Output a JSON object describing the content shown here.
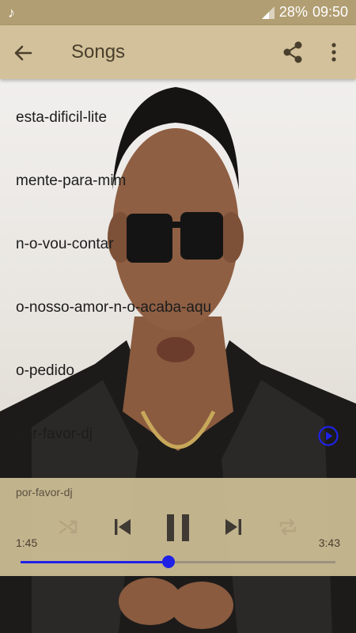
{
  "status_bar": {
    "battery": "28%",
    "time": "09:50",
    "notification_icon": "music-note-icon",
    "signal_icon": "signal-icon"
  },
  "app_bar": {
    "title": "Songs",
    "back_icon": "arrow-back-icon",
    "share_icon": "share-icon",
    "more_icon": "more-vert-icon",
    "color": "#d2c19a"
  },
  "songs": [
    {
      "title": "esta-dificil-lite"
    },
    {
      "title": "mente-para-mim"
    },
    {
      "title": "n-o-vou-contar"
    },
    {
      "title": "o-nosso-amor-n-o-acaba-aqu"
    },
    {
      "title": "o-pedido"
    },
    {
      "title": "por-favor-dj",
      "playing": true
    }
  ],
  "player": {
    "now_playing": "por-favor-dj",
    "elapsed": "1:45",
    "total": "3:43",
    "progress": 0.47,
    "accent": "#1f22e6",
    "controls": [
      "shuffle-icon",
      "skip-previous-icon",
      "pause-icon",
      "skip-next-icon",
      "repeat-icon"
    ]
  }
}
